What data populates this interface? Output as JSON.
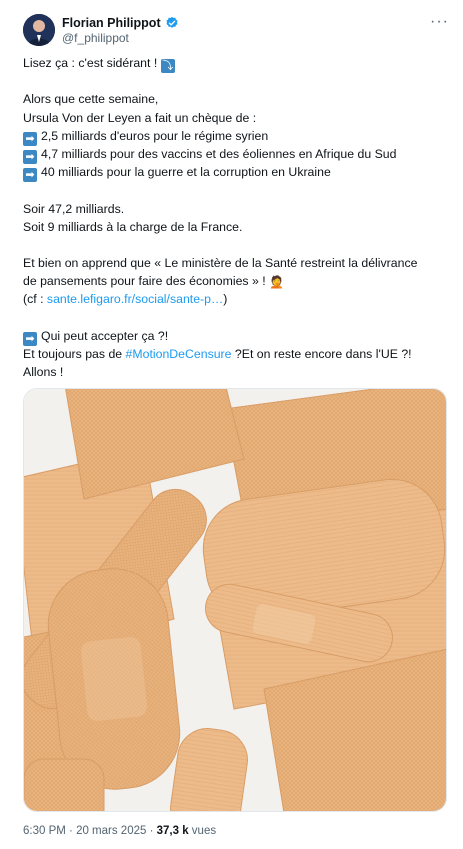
{
  "author": {
    "display_name": "Florian Philippot",
    "handle": "@f_philippot",
    "verified": true
  },
  "more_icon": "more-options-icon",
  "tweet": {
    "line1_text": "Lisez ça : c'est sidérant !",
    "line1_emoji": "arrow-down-right-icon",
    "line3": "Alors que cette semaine,",
    "line4": "Ursula Von der Leyen a fait un chèque de :",
    "items": [
      "2,5 milliards d'euros pour le régime syrien",
      "4,7 milliards pour des vaccins et des éoliennes en Afrique du Sud",
      "40 milliards pour la guerre et la corruption en Ukraine"
    ],
    "total_line": "Soir 47,2 milliards.",
    "france_line": "Soit 9 milliards à la charge de la France.",
    "news_line1": "Et bien on apprend que « Le ministère de la Santé restreint la délivrance",
    "news_line2": "de pansements pour faire des économies » !",
    "news_emoji": "person-facepalming-icon",
    "cf_prefix": "(cf : ",
    "cf_link": "sante.lefigaro.fr/social/sante-p…",
    "cf_suffix": ")",
    "question": "Qui peut accepter ça ?!",
    "hashtag_prefix": "Et toujours pas de ",
    "hashtag": "#MotionDeCensure",
    "hashtag_suffix": " ?Et on reste encore dans l'UE ?!",
    "closing": "Allons !"
  },
  "colors": {
    "link": "#1d9bf0",
    "arrow_emoji_bg": "#3b88c3",
    "bandage": "#e8b27c"
  },
  "media": {
    "subject": "adhesive bandages"
  },
  "footer": {
    "time": "6:30 PM",
    "separator": " · ",
    "date": "20 mars 2025",
    "views_count": "37,3 k",
    "views_label": " vues"
  }
}
